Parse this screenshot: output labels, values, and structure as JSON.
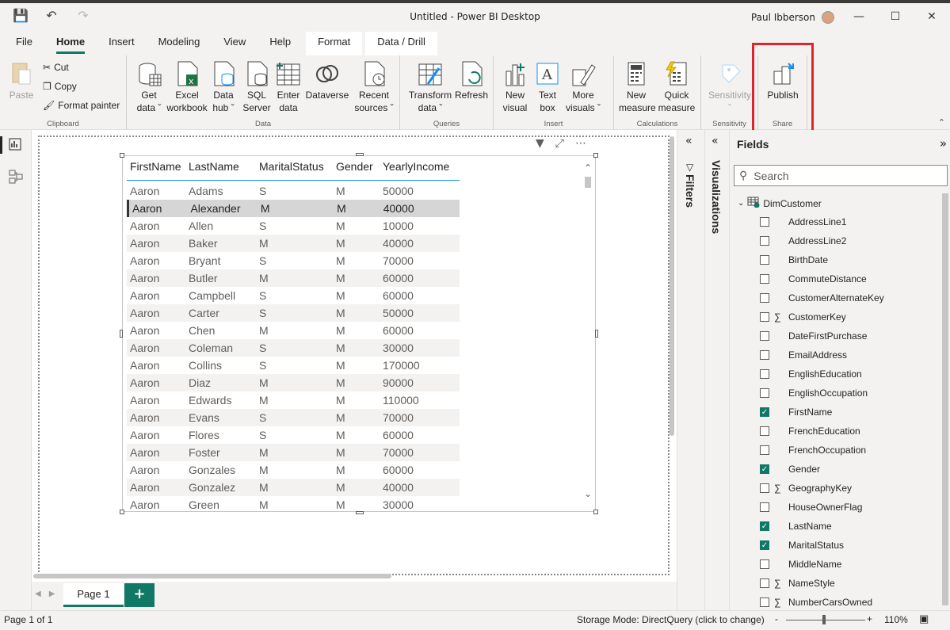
{
  "window": {
    "title": "Untitled - Power BI Desktop",
    "user": "Paul Ibberson"
  },
  "menu": [
    "File",
    "Home",
    "Insert",
    "Modeling",
    "View",
    "Help",
    "Format",
    "Data / Drill"
  ],
  "ribbon": {
    "clipboard": {
      "paste": "Paste",
      "cut": "Cut",
      "copy": "Copy",
      "format_painter": "Format painter",
      "label": "Clipboard"
    },
    "data": {
      "get_data": [
        "Get",
        "data"
      ],
      "excel": [
        "Excel",
        "workbook"
      ],
      "data_hub": [
        "Data",
        "hub"
      ],
      "sql": [
        "SQL",
        "Server"
      ],
      "enter": [
        "Enter",
        "data"
      ],
      "dataverse": "Dataverse",
      "recent": [
        "Recent",
        "sources"
      ],
      "label": "Data"
    },
    "queries": {
      "transform": [
        "Transform",
        "data"
      ],
      "refresh": "Refresh",
      "label": "Queries"
    },
    "insert": {
      "new_visual": [
        "New",
        "visual"
      ],
      "text_box": [
        "Text",
        "box"
      ],
      "more_visuals": [
        "More",
        "visuals"
      ],
      "label": "Insert"
    },
    "calculations": {
      "new_measure": [
        "New",
        "measure"
      ],
      "quick_measure": [
        "Quick",
        "measure"
      ],
      "label": "Calculations"
    },
    "sensitivity": {
      "btn": "Sensitivity",
      "label": "Sensitivity"
    },
    "share": {
      "publish": "Publish",
      "label": "Share"
    }
  },
  "table": {
    "headers": [
      "FirstName",
      "LastName",
      "MaritalStatus",
      "Gender",
      "YearlyIncome"
    ],
    "rows": [
      [
        "Aaron",
        "Adams",
        "S",
        "M",
        "50000"
      ],
      [
        "Aaron",
        "Alexander",
        "M",
        "M",
        "40000"
      ],
      [
        "Aaron",
        "Allen",
        "S",
        "M",
        "10000"
      ],
      [
        "Aaron",
        "Baker",
        "M",
        "M",
        "40000"
      ],
      [
        "Aaron",
        "Bryant",
        "S",
        "M",
        "70000"
      ],
      [
        "Aaron",
        "Butler",
        "M",
        "M",
        "60000"
      ],
      [
        "Aaron",
        "Campbell",
        "S",
        "M",
        "60000"
      ],
      [
        "Aaron",
        "Carter",
        "S",
        "M",
        "50000"
      ],
      [
        "Aaron",
        "Chen",
        "M",
        "M",
        "60000"
      ],
      [
        "Aaron",
        "Coleman",
        "S",
        "M",
        "30000"
      ],
      [
        "Aaron",
        "Collins",
        "S",
        "M",
        "170000"
      ],
      [
        "Aaron",
        "Diaz",
        "M",
        "M",
        "90000"
      ],
      [
        "Aaron",
        "Edwards",
        "M",
        "M",
        "110000"
      ],
      [
        "Aaron",
        "Evans",
        "S",
        "M",
        "70000"
      ],
      [
        "Aaron",
        "Flores",
        "S",
        "M",
        "60000"
      ],
      [
        "Aaron",
        "Foster",
        "M",
        "M",
        "70000"
      ],
      [
        "Aaron",
        "Gonzales",
        "M",
        "M",
        "60000"
      ],
      [
        "Aaron",
        "Gonzalez",
        "M",
        "M",
        "40000"
      ],
      [
        "Aaron",
        "Green",
        "M",
        "M",
        "30000"
      ]
    ],
    "selected_row": 1
  },
  "pages": {
    "current": "Page 1",
    "add": "+"
  },
  "panes": {
    "filters": "Filters",
    "visualizations": "Visualizations",
    "fields": "Fields",
    "search_placeholder": "Search"
  },
  "fields": {
    "table_name": "DimCustomer",
    "items": [
      {
        "name": "AddressLine1",
        "checked": false,
        "sigma": false
      },
      {
        "name": "AddressLine2",
        "checked": false,
        "sigma": false
      },
      {
        "name": "BirthDate",
        "checked": false,
        "sigma": false
      },
      {
        "name": "CommuteDistance",
        "checked": false,
        "sigma": false
      },
      {
        "name": "CustomerAlternateKey",
        "checked": false,
        "sigma": false
      },
      {
        "name": "CustomerKey",
        "checked": false,
        "sigma": true
      },
      {
        "name": "DateFirstPurchase",
        "checked": false,
        "sigma": false
      },
      {
        "name": "EmailAddress",
        "checked": false,
        "sigma": false
      },
      {
        "name": "EnglishEducation",
        "checked": false,
        "sigma": false
      },
      {
        "name": "EnglishOccupation",
        "checked": false,
        "sigma": false
      },
      {
        "name": "FirstName",
        "checked": true,
        "sigma": false
      },
      {
        "name": "FrenchEducation",
        "checked": false,
        "sigma": false
      },
      {
        "name": "FrenchOccupation",
        "checked": false,
        "sigma": false
      },
      {
        "name": "Gender",
        "checked": true,
        "sigma": false
      },
      {
        "name": "GeographyKey",
        "checked": false,
        "sigma": true
      },
      {
        "name": "HouseOwnerFlag",
        "checked": false,
        "sigma": false
      },
      {
        "name": "LastName",
        "checked": true,
        "sigma": false
      },
      {
        "name": "MaritalStatus",
        "checked": true,
        "sigma": false
      },
      {
        "name": "MiddleName",
        "checked": false,
        "sigma": false
      },
      {
        "name": "NameStyle",
        "checked": false,
        "sigma": true
      },
      {
        "name": "NumberCarsOwned",
        "checked": false,
        "sigma": true
      }
    ]
  },
  "status": {
    "page": "Page 1 of 1",
    "storage": "Storage Mode: DirectQuery (click to change)",
    "zoom": "110%",
    "minus": "-",
    "plus": "+"
  },
  "colors": {
    "accent": "#117865",
    "highlight": "#e0242b",
    "header_line": "#118dff"
  }
}
